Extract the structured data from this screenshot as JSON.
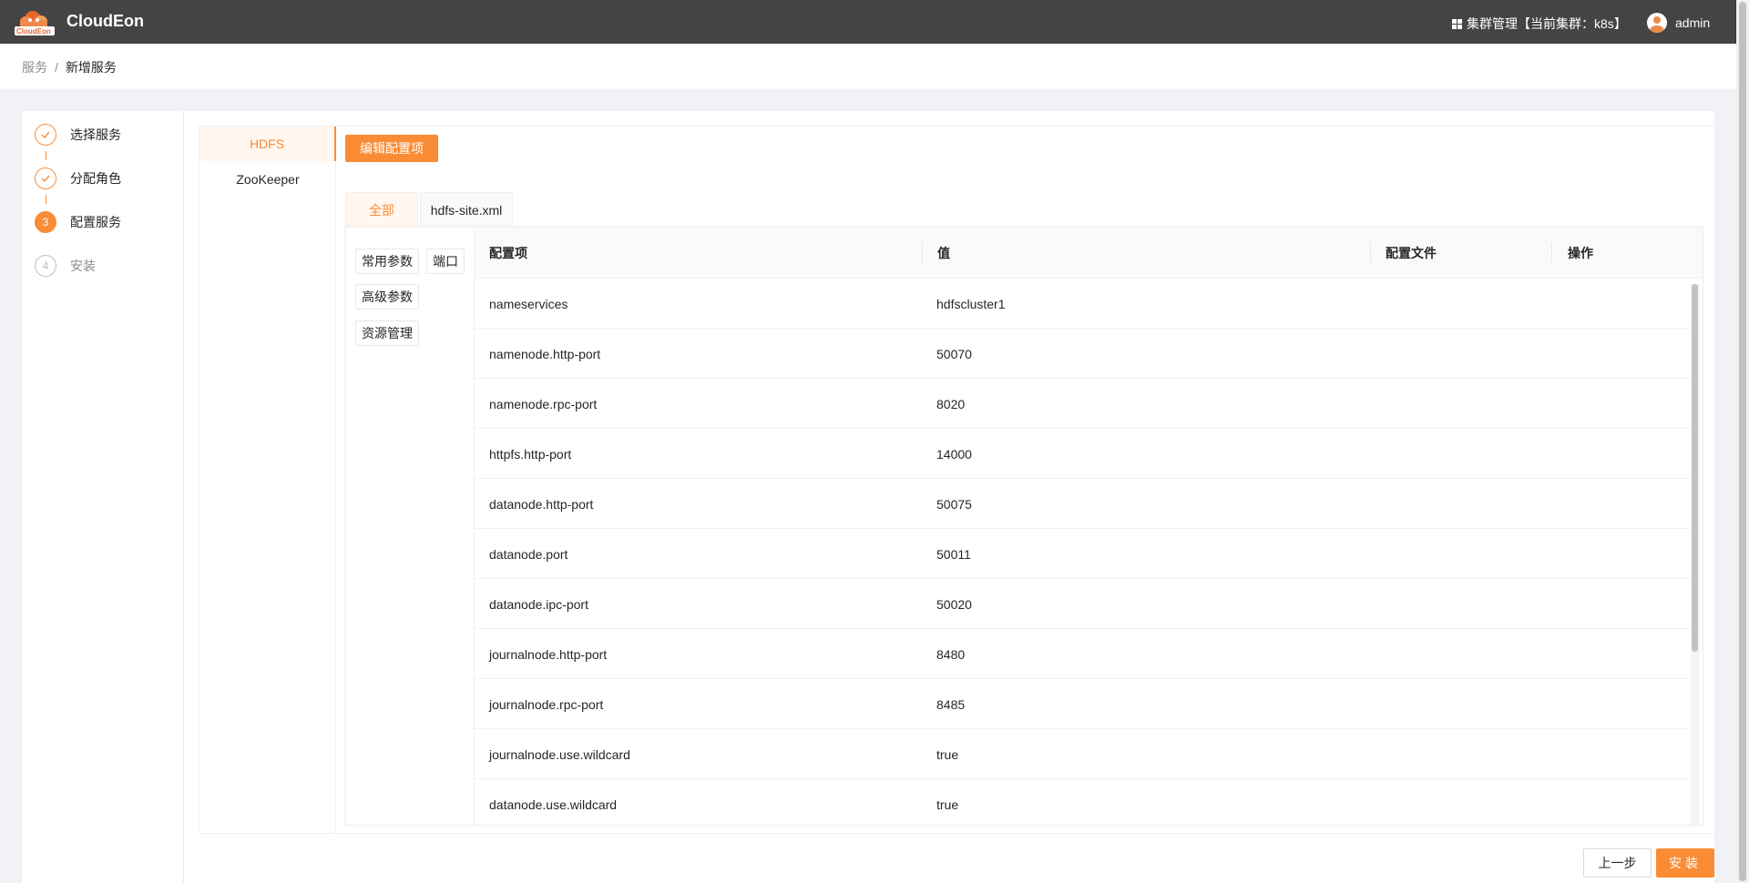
{
  "app": {
    "brand": "CloudEon",
    "logo_text": "CloudEon"
  },
  "header": {
    "cluster_label": "集群管理【当前集群：k8s】",
    "user": "admin"
  },
  "breadcrumb": {
    "root": "服务",
    "separator": "/",
    "current": "新增服务"
  },
  "steps": [
    {
      "label": "选择服务",
      "state": "done"
    },
    {
      "label": "分配角色",
      "state": "done"
    },
    {
      "label": "配置服务",
      "state": "active",
      "number": "3"
    },
    {
      "label": "安装",
      "state": "wait",
      "number": "4"
    }
  ],
  "services": [
    {
      "label": "HDFS",
      "active": true
    },
    {
      "label": "ZooKeeper",
      "active": false
    }
  ],
  "toolbar": {
    "edit_label": "编辑配置项"
  },
  "tabs": [
    {
      "label": "全部",
      "active": true
    },
    {
      "label": "hdfs-site.xml",
      "active": false
    }
  ],
  "categories": [
    "常用参数",
    "端口",
    "高级参数",
    "资源管理"
  ],
  "table": {
    "headers": [
      "配置项",
      "值",
      "配置文件",
      "操作"
    ],
    "rows": [
      {
        "name": "nameservices",
        "value": "hdfscluster1"
      },
      {
        "name": "namenode.http-port",
        "value": "50070"
      },
      {
        "name": "namenode.rpc-port",
        "value": "8020"
      },
      {
        "name": "httpfs.http-port",
        "value": "14000"
      },
      {
        "name": "datanode.http-port",
        "value": "50075"
      },
      {
        "name": "datanode.port",
        "value": "50011"
      },
      {
        "name": "datanode.ipc-port",
        "value": "50020"
      },
      {
        "name": "journalnode.http-port",
        "value": "8480"
      },
      {
        "name": "journalnode.rpc-port",
        "value": "8485"
      },
      {
        "name": "journalnode.use.wildcard",
        "value": "true"
      },
      {
        "name": "datanode.use.wildcard",
        "value": "true"
      }
    ]
  },
  "footer": {
    "prev_label": "上一步",
    "install_label": "安装"
  },
  "colors": {
    "accent": "#fa8c35",
    "topbar": "#444444"
  }
}
